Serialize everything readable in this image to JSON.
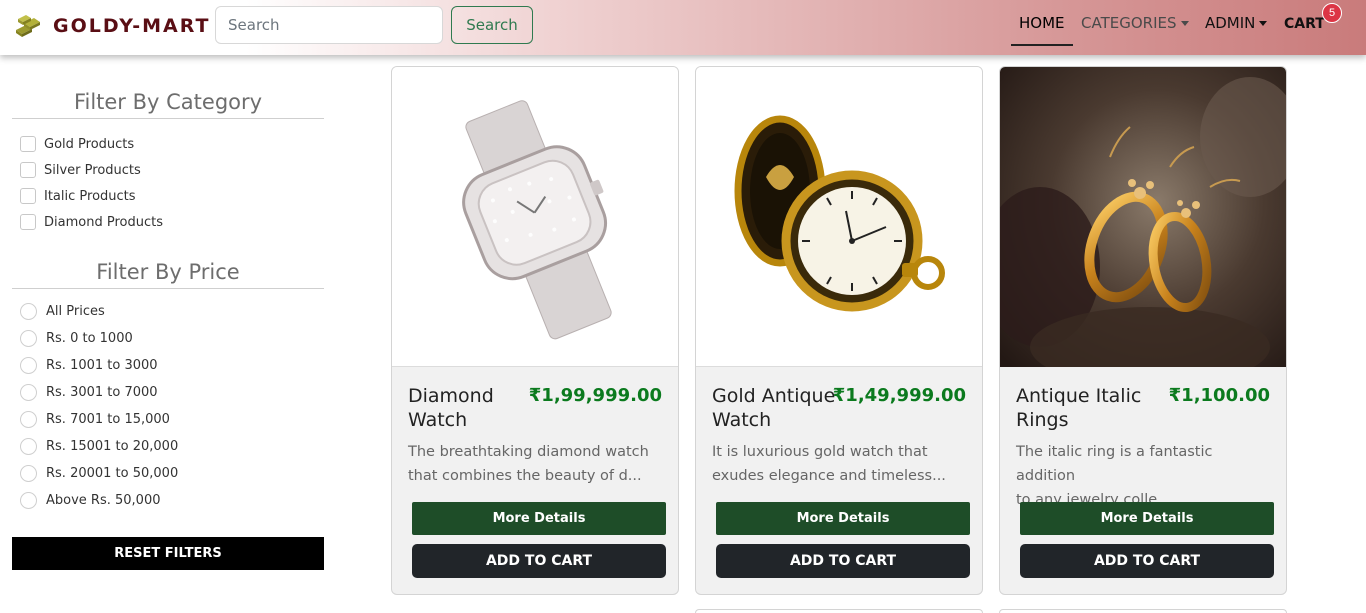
{
  "header": {
    "brand": "GOLDY-MART",
    "search_placeholder": "Search",
    "search_button": "Search",
    "nav": {
      "home": "HOME",
      "categories": "CATEGORIES",
      "admin": "ADMIN",
      "cart": "CART",
      "cart_count": "5"
    }
  },
  "filters": {
    "category_title": "Filter By Category",
    "categories": [
      "Gold Products",
      "Silver Products",
      "Italic Products",
      "Diamond Products"
    ],
    "price_title": "Filter By Price",
    "prices": [
      "All Prices",
      "Rs. 0 to 1000",
      "Rs. 1001 to 3000",
      "Rs. 3001 to 7000",
      "Rs. 7001 to 15,000",
      "Rs. 15001 to 20,000",
      "Rs. 20001 to 50,000",
      "Above Rs. 50,000"
    ],
    "reset_label": "RESET FILTERS"
  },
  "products": [
    {
      "name": "Diamond Watch",
      "price": "₹1,99,999.00",
      "desc_line1": "The breathtaking diamond watch",
      "desc_line2": "that combines the beauty of d...",
      "details_label": "More Details",
      "cart_label": "ADD TO CART"
    },
    {
      "name": "Gold Antique Watch",
      "price": "₹1,49,999.00",
      "desc_line1": "It is luxurious gold watch that",
      "desc_line2": "exudes elegance and timeless...",
      "details_label": "More Details",
      "cart_label": "ADD TO CART"
    },
    {
      "name": "Antique Italic Rings",
      "price": "₹1,100.00",
      "desc_line1": "The italic ring is a fantastic addition",
      "desc_line2": "to any jewelry colle...",
      "details_label": "More Details",
      "cart_label": "ADD TO CART"
    }
  ],
  "colors": {
    "brand": "#5a0e14",
    "price": "#0b7a1e",
    "details_button": "#1e4d28",
    "cart_button": "#212529",
    "badge": "#dc3545"
  }
}
